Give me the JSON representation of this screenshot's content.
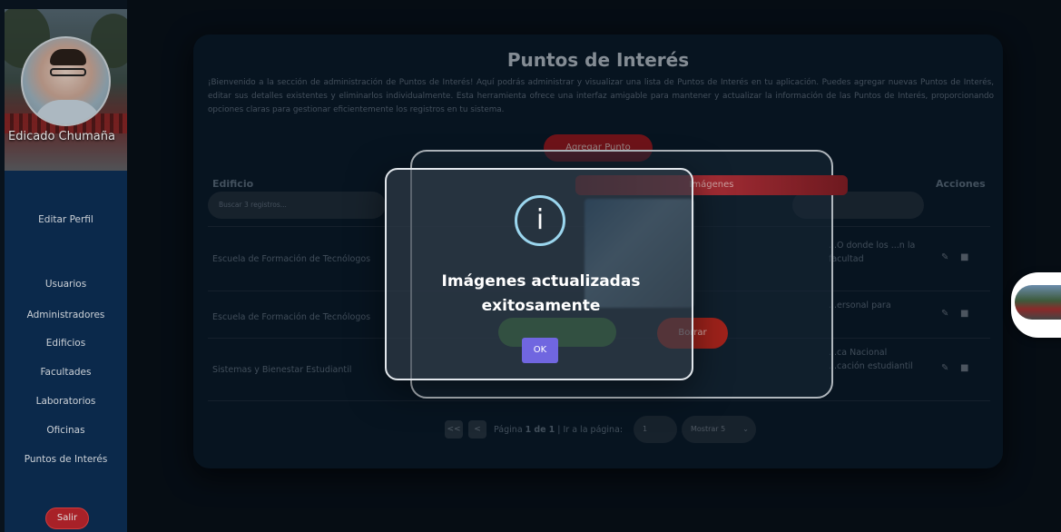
{
  "user": {
    "name": "Edicado Chumaña"
  },
  "sidebar": {
    "edit_profile": "Editar Perfil",
    "items": [
      {
        "label": "Usuarios"
      },
      {
        "label": "Administradores"
      },
      {
        "label": "Edificios"
      },
      {
        "label": "Facultades"
      },
      {
        "label": "Laboratorios"
      },
      {
        "label": "Oficinas"
      },
      {
        "label": "Puntos de Interés"
      }
    ],
    "logout": "Salir"
  },
  "main": {
    "title": "Puntos de Interés",
    "description": "¡Bienvenido a la sección de administración de Puntos de Interés! Aquí podrás administrar y visualizar una lista de Puntos de Interés en tu aplicación. Puedes agregar nuevas Puntos de Interés, editar sus detalles existentes y eliminarlos individualmente. Esta herramienta ofrece una interfaz amigable para mantener y actualizar la información de las Puntos de Interés, proporcionando opciones claras para gestionar eficientemente los registros en tu sistema.",
    "add_button": "Agregar Punto",
    "columns": {
      "building": "Edificio",
      "actions": "Acciones"
    },
    "filter_placeholder": "Buscar 3 registros...",
    "rows": [
      {
        "building": "Escuela de Formación de Tecnólogos",
        "description": "...O donde los ...n la facultad"
      },
      {
        "building": "Escuela de Formación de Tecnólogos",
        "description": "...ersonal para"
      },
      {
        "building": "Sistemas y Bienestar Estudiantil",
        "description": "...ca Nacional ...cación estudiantil"
      }
    ],
    "pagination": {
      "prev_first": "<<",
      "prev": "<",
      "page_label": "Página",
      "page": "1",
      "of": "de",
      "total": "1",
      "goto_label": "| Ir a la página:",
      "goto_value": "1",
      "show": "Mostrar 5"
    }
  },
  "edit_modal": {
    "header": "Imágenes",
    "delete": "Borrar"
  },
  "alert": {
    "icon": "info-icon",
    "message": "Imágenes actualizadas exitosamente",
    "ok": "OK"
  },
  "colors": {
    "accent": "#7066e0",
    "sidebar": "#0d2f56",
    "danger": "#c0262e"
  }
}
